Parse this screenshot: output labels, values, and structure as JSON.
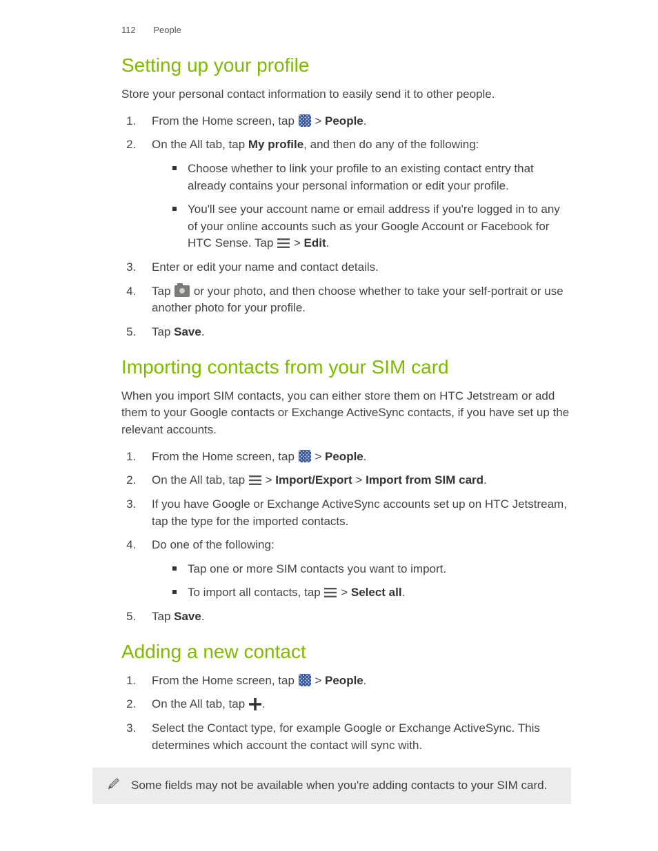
{
  "header": {
    "page_number": "112",
    "section": "People"
  },
  "s1": {
    "title": "Setting up your profile",
    "intro": "Store your personal contact information to easily send it to other people.",
    "step1_a": "From the Home screen, tap ",
    "step1_sep": " > ",
    "people": "People",
    "period": ".",
    "step2_a": "On the All tab, tap ",
    "my_profile": "My profile",
    "step2_b": ", and then do any of the following:",
    "bullet1": "Choose whether to link your profile to an existing contact entry that already contains your personal information or edit your profile.",
    "bullet2_a": "You'll see your account name or email address if you're logged in to any of your online accounts such as your Google Account or Facebook for HTC Sense. Tap ",
    "bullet2_sep": " > ",
    "edit": "Edit",
    "step3": "Enter or edit your name and contact details.",
    "step4_a": "Tap ",
    "step4_b": " or your photo, and then choose whether to take your self-portrait or use another photo for your profile.",
    "step5_a": "Tap ",
    "save": "Save"
  },
  "s2": {
    "title": "Importing contacts from your SIM card",
    "intro": "When you import SIM contacts, you can either store them on HTC Jetstream or add them to your Google contacts or Exchange ActiveSync contacts, if you have set up the relevant accounts.",
    "step1_a": "From the Home screen, tap ",
    "sep": " > ",
    "people": "People",
    "period": ".",
    "step2_a": "On the All tab, tap ",
    "import_export": "Import/Export",
    "import_from_sim": "Import from SIM card",
    "step3": "If you have Google or Exchange ActiveSync accounts set up on HTC Jetstream, tap the type for the imported contacts.",
    "step4": "Do one of the following:",
    "bullet1": "Tap one or more SIM contacts you want to import.",
    "bullet2_a": "To import all contacts, tap ",
    "select_all": "Select all",
    "step5_a": "Tap ",
    "save": "Save"
  },
  "s3": {
    "title": "Adding a new contact",
    "step1_a": "From the Home screen, tap ",
    "sep": " > ",
    "people": "People",
    "period": ".",
    "step2_a": "On the All tab, tap ",
    "step3": "Select the Contact type, for example Google or Exchange ActiveSync. This determines which account the contact will sync with."
  },
  "note": "Some fields may not be available when you're adding contacts to your SIM card."
}
